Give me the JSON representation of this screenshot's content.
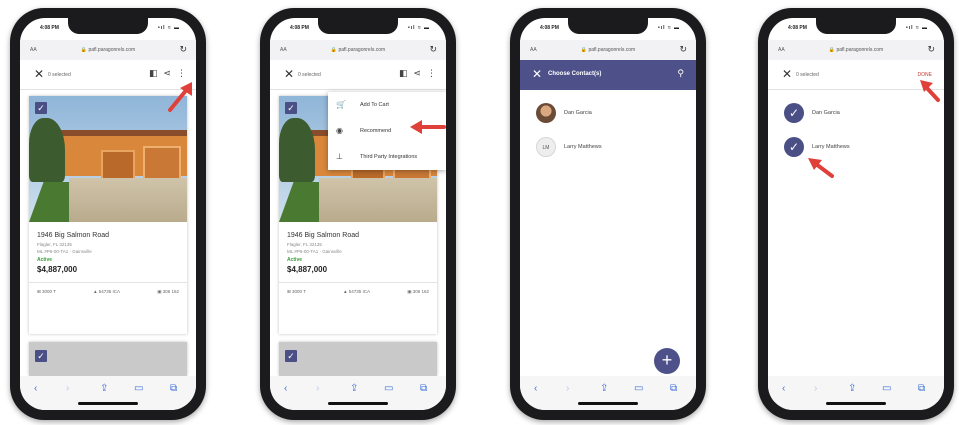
{
  "colors": {
    "accent": "#4e5189",
    "arrow": "#e0403a",
    "active": "#3c9a3c",
    "link": "#3d6fd6"
  },
  "status_bar": {
    "time": "4:08 PM",
    "signal": "•ıl ≈ ▬"
  },
  "url_bar": {
    "text_size": "AA",
    "url": "🔒 pafl.paragonrels.com",
    "reload_icon": "↻"
  },
  "screen1": {
    "selected_label": "0 selected",
    "listing": {
      "address": "1946 Big Salmon Road",
      "city": "Flagler, FL 32135",
      "mls": "ML #P6-00-TA1 · Gainsville",
      "status": "Active",
      "price": "$4,887,000",
      "stats": [
        "⊞ 3000 T",
        "▲ 54735 ICA",
        "▣ 306 162"
      ]
    }
  },
  "screen2": {
    "selected_label": "0 selected",
    "menu": [
      {
        "icon": "cart-icon",
        "glyph": "🛒",
        "label": "Add To Cart"
      },
      {
        "icon": "recommend-icon",
        "glyph": "◉",
        "label": "Recommend"
      },
      {
        "icon": "third-party-icon",
        "glyph": "⊥",
        "label": "Third Party Integrations"
      }
    ]
  },
  "screen3": {
    "title": "Choose Contact(s)",
    "contacts": [
      {
        "name": "Dan Garcia",
        "initials": ""
      },
      {
        "name": "Larry Matthews",
        "initials": "LM"
      }
    ],
    "fab": "+"
  },
  "screen4": {
    "selected_label": "0 selected",
    "done_label": "DONE",
    "contacts": [
      {
        "name": "Dan Garcia",
        "checked": true
      },
      {
        "name": "Larry Matthews",
        "checked": true
      }
    ]
  },
  "toolbar": {
    "back": "‹",
    "forward": "›",
    "share": "⇪",
    "bookmarks": "▭",
    "tabs": "⧉"
  },
  "glyphs": {
    "close": "✕",
    "check": "✓",
    "search": "⚲",
    "compare": "◧",
    "share": "⋖",
    "more": "⋮"
  }
}
